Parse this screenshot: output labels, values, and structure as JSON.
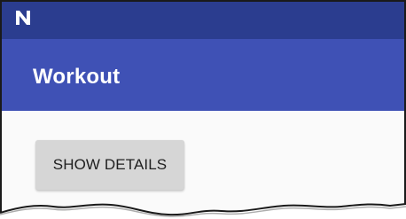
{
  "status_bar": {
    "icon": "notification-n-icon",
    "color": "#2b3d8f"
  },
  "app_bar": {
    "title": "Workout",
    "color": "#3f51b5"
  },
  "content": {
    "show_details_label": "SHOW DETAILS",
    "button_color": "#d6d6d6"
  }
}
